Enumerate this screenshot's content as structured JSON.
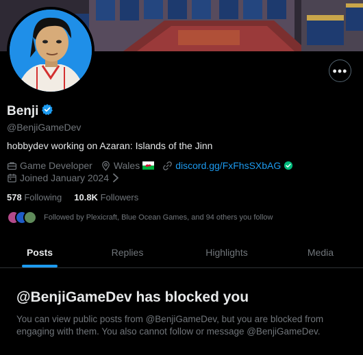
{
  "profile": {
    "display_name": "Benji",
    "handle": "@BenjiGameDev",
    "bio": "hobbydev working on Azaran: Islands of the Jinn",
    "verified": true,
    "occupation": "Game Developer",
    "location": "Wales",
    "location_flag": "🏴",
    "website": "discord.gg/FxFhsSXbAG",
    "joined": "Joined January 2024",
    "following_count": "578",
    "following_label": "Following",
    "followers_count": "10.8K",
    "followers_label": "Followers",
    "followed_by": "Followed by Plexicraft, Blue Ocean Games, and 94 others you follow"
  },
  "tabs": [
    {
      "label": "Posts",
      "active": true
    },
    {
      "label": "Replies",
      "active": false
    },
    {
      "label": "Highlights",
      "active": false
    },
    {
      "label": "Media",
      "active": false
    }
  ],
  "blocked": {
    "title": "@BenjiGameDev has blocked you",
    "description": "You can view public posts from @BenjiGameDev, but you are blocked from engaging with them. You also cannot follow or message @BenjiGameDev."
  },
  "colors": {
    "background": "#000000",
    "accent": "#1d9bf0",
    "text_primary": "#e7e9ea",
    "text_secondary": "#71767b",
    "divider": "#2f3336",
    "verified_check": "#1d9bf0",
    "website_check": "#00ba7c"
  },
  "icons": {
    "more": "more-options-icon",
    "verified": "verified-badge-icon",
    "occupation": "briefcase-icon",
    "location": "location-pin-icon",
    "website": "link-icon",
    "joined": "calendar-icon",
    "joined_chevron": "chevron-right-icon"
  }
}
